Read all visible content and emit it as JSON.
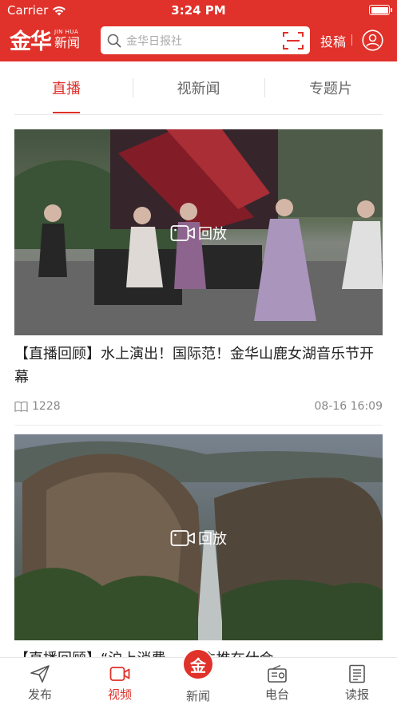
{
  "status_bar": {
    "carrier": "Carrier",
    "time": "3:24 PM"
  },
  "brand": {
    "logo_text": "金华",
    "en": "JIN HUA",
    "cn": "新闻"
  },
  "search": {
    "placeholder": "金华日报社"
  },
  "header": {
    "submit_label": "投稿"
  },
  "tabs": [
    {
      "label": "直播",
      "active": true
    },
    {
      "label": "视新闻",
      "active": false
    },
    {
      "label": "专题片",
      "active": false
    }
  ],
  "cards": [
    {
      "title": "【直播回顾】水上演出！国际范！金华山鹿女湖音乐节开幕",
      "replay_label": "回放",
      "views": "1228",
      "date": "08-16 16:09"
    },
    {
      "title": "【直播回顾】“沪上消费……”主推在仕会",
      "replay_label": "回放"
    }
  ],
  "bottom_nav": [
    {
      "label": "发布",
      "icon": "send-icon"
    },
    {
      "label": "视频",
      "icon": "video-icon",
      "active": true
    },
    {
      "label": "新闻",
      "icon": "jinhua-logo-icon",
      "center_glyph": "金"
    },
    {
      "label": "电台",
      "icon": "radio-icon"
    },
    {
      "label": "读报",
      "icon": "newspaper-icon"
    }
  ],
  "colors": {
    "brand_red": "#e0312a"
  }
}
